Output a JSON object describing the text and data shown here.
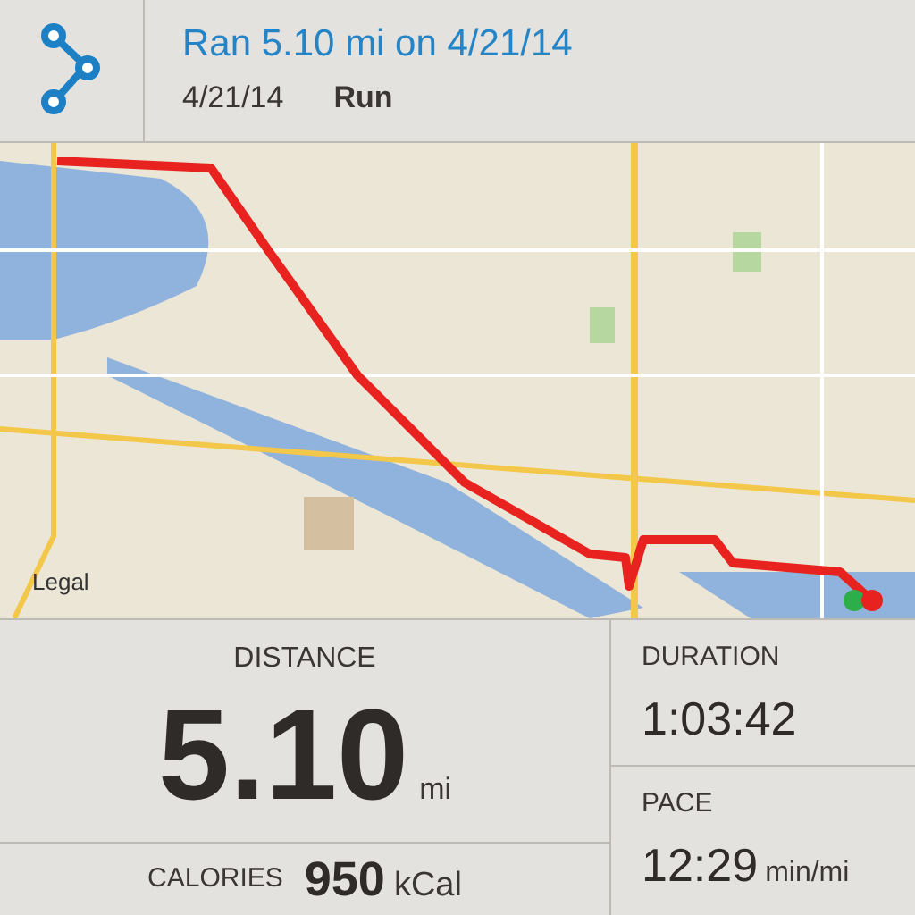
{
  "header": {
    "title": "Ran 5.10 mi on 4/21/14",
    "date": "4/21/14",
    "activity": "Run"
  },
  "map": {
    "kind": "picture",
    "legal_link": "Legal"
  },
  "distance": {
    "label": "DISTANCE",
    "value": "5.10",
    "unit": "mi"
  },
  "calories": {
    "label": "CALORIES",
    "value": "950",
    "unit": "kCal"
  },
  "duration": {
    "label": "DURATION",
    "value": "1:03:42"
  },
  "pace": {
    "label": "PACE",
    "value": "12:29",
    "unit": "min/mi"
  }
}
